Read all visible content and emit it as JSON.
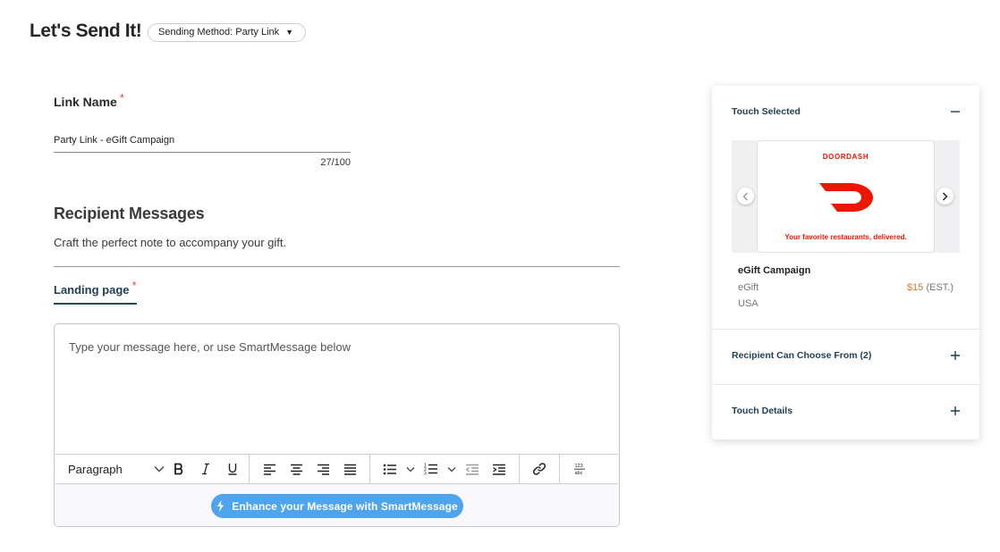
{
  "header": {
    "title": "Let's Send It!",
    "method_select": "Sending Method: Party Link"
  },
  "link_name": {
    "label": "Link Name",
    "required_mark": "*",
    "value": "Party Link - eGift Campaign",
    "counter": "27/100"
  },
  "recipient": {
    "title": "Recipient Messages",
    "subtitle": "Craft the perfect note to accompany your gift.",
    "tab_label": "Landing page",
    "tab_required_mark": "*"
  },
  "editor": {
    "placeholder": "Type your message here, or use SmartMessage below",
    "paragraph_label": "Paragraph",
    "smart_button_label": "Enhance your Message with SmartMessage"
  },
  "panel": {
    "touch_selected_label": "Touch Selected",
    "card_brand": "DOORDASH",
    "card_tagline": "Your favorite restaurants, delivered.",
    "gift_name": "eGift Campaign",
    "gift_type": "eGift",
    "price_amount": "$15",
    "price_suffix": "(EST.)",
    "country": "USA",
    "choose_from_label": "Recipient Can Choose From (2)",
    "touch_details_label": "Touch Details"
  },
  "colors": {
    "accent_navy": "#1f3e52",
    "required_red": "#e5483d",
    "smart_blue": "#4fa4f0",
    "doordash_red": "#eb1700",
    "price_orange": "#e5792a"
  }
}
